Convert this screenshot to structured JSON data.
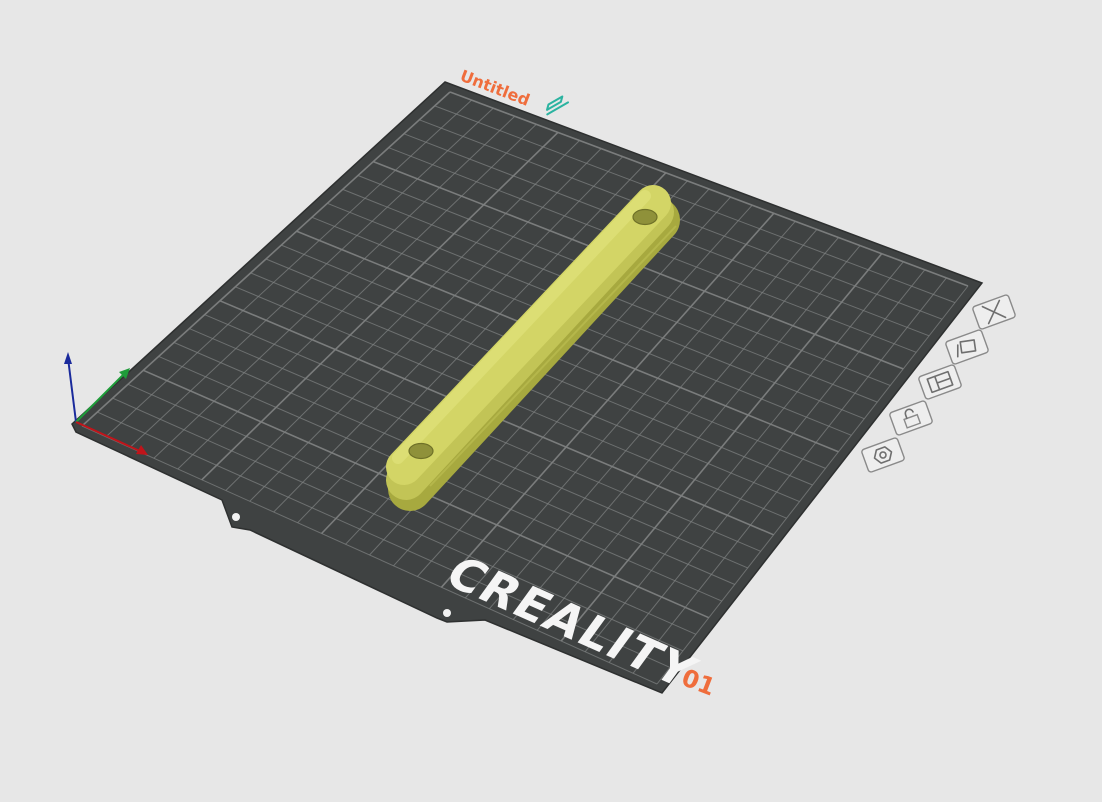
{
  "viewport": {
    "background_color": "#e7e7e7"
  },
  "plate": {
    "name": "Untitled",
    "number": "01",
    "brand": "CREALITY",
    "surface_color": "#3f4242",
    "grid_color": "#7d8080",
    "label_color": "#ef6d3c",
    "edit_icon_color": "#2bb3a0",
    "edit_icon": "pencil-icon",
    "toolbar": [
      {
        "id": "delete-plate",
        "icon": "close-icon"
      },
      {
        "id": "auto-orient",
        "icon": "orient-icon"
      },
      {
        "id": "arrange",
        "icon": "arrange-icon"
      },
      {
        "id": "lock-plate",
        "icon": "lock-icon"
      },
      {
        "id": "plate-settings",
        "icon": "hexagon-settings-icon"
      }
    ]
  },
  "model": {
    "color": "#d3d566",
    "shadow_color": "#a7a93f"
  },
  "axes": {
    "x_color": "#c0141a",
    "y_color": "#1f9c3a",
    "z_color": "#1a2a9c"
  }
}
